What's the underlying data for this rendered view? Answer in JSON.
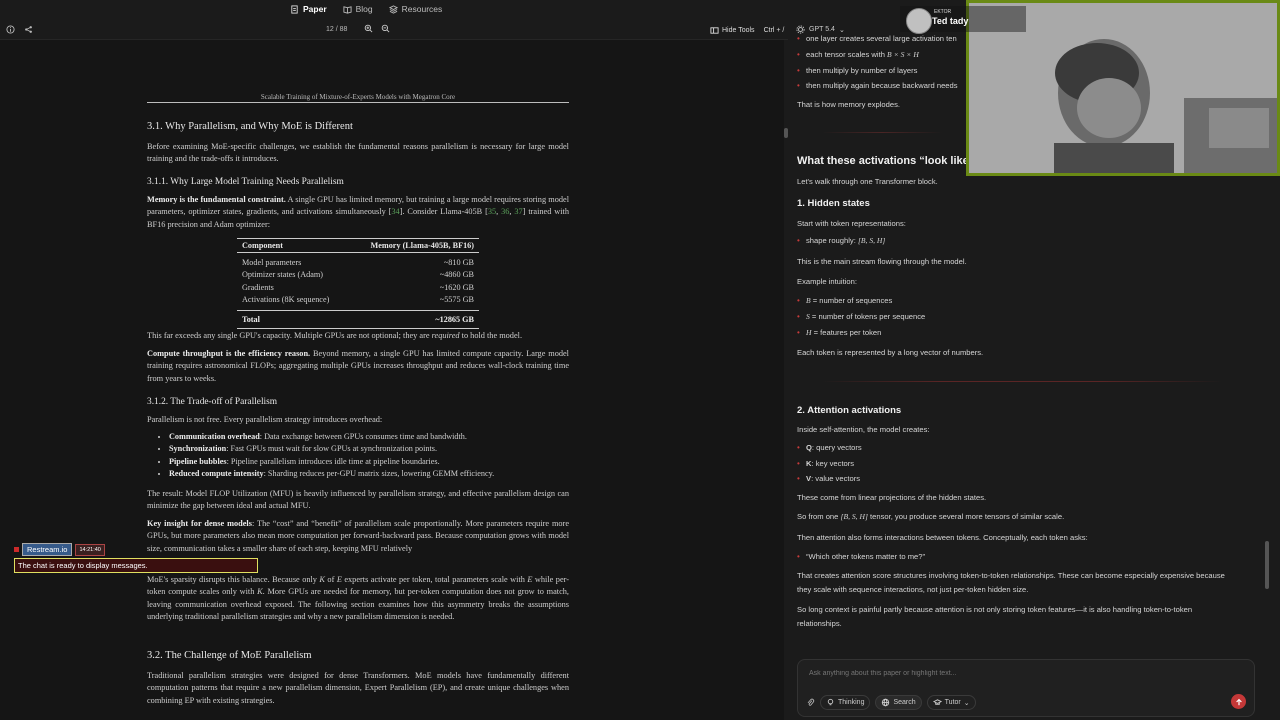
{
  "nav": {
    "tabs": [
      {
        "label": "Paper",
        "icon": "document-icon",
        "active": true
      },
      {
        "label": "Blog",
        "icon": "book-icon",
        "active": false
      },
      {
        "label": "Resources",
        "icon": "layers-icon",
        "active": false
      }
    ]
  },
  "pdf_toolbar": {
    "page_indicator": "12 / 88",
    "hide_tools_label": "Hide Tools",
    "hide_tools_shortcut": "Ctrl + /"
  },
  "paper": {
    "running_head": "Scalable Training of Mixture-of-Experts Models with Megatron Core",
    "s31_title": "3.1.  Why Parallelism, and Why MoE is Different",
    "s31_intro": "Before examining MoE-specific challenges, we establish the fundamental reasons parallelism is necessary for large model training and the trade-offs it introduces.",
    "s311_title": "3.1.1.  Why Large Model Training Needs Parallelism",
    "mem_lead": "Memory is the fundamental constraint.",
    "mem_text_a": " A single GPU has limited memory, but training a large model requires storing model parameters, optimizer states, gradients, and activations simultaneously [",
    "mem_cite1": "34",
    "mem_text_b": "]. Consider Llama-405B [",
    "mem_cite2": "35",
    "mem_cite3": "36",
    "mem_cite4": "37",
    "mem_text_c": "] trained with BF16 precision and Adam optimizer:",
    "table": {
      "col1": "Component",
      "col2": "Memory (Llama-405B, BF16)",
      "rows": [
        {
          "c": "Model parameters",
          "v": "~810 GB"
        },
        {
          "c": "Optimizer states (Adam)",
          "v": "~4860 GB"
        },
        {
          "c": "Gradients",
          "v": "~1620 GB"
        },
        {
          "c": "Activations (8K sequence)",
          "v": "~5575 GB"
        }
      ],
      "total_label": "Total",
      "total_value": "~12865 GB"
    },
    "exceeds_a": "This far exceeds any single GPU's capacity. Multiple GPUs are not optional; they are ",
    "exceeds_em": "required",
    "exceeds_b": " to hold the model.",
    "compute_lead": "Compute throughput is the efficiency reason.",
    "compute_text": " Beyond memory, a single GPU has limited compute capacity. Large model training requires astronomical FLOPs; aggregating multiple GPUs increases throughput and reduces wall-clock training time from years to weeks.",
    "s312_title": "3.1.2.  The Trade-off of Parallelism",
    "tradeoff_intro": "Parallelism is not free. Every parallelism strategy introduces overhead:",
    "bullets": [
      {
        "lead": "Communication overhead",
        "text": ": Data exchange between GPUs consumes time and bandwidth."
      },
      {
        "lead": "Synchronization",
        "text": ": Fast GPUs must wait for slow GPUs at synchronization points."
      },
      {
        "lead": "Pipeline bubbles",
        "text": ": Pipeline parallelism introduces idle time at pipeline boundaries."
      },
      {
        "lead": "Reduced compute intensity",
        "text": ": Sharding reduces per-GPU matrix sizes, lowering GEMM efficiency."
      }
    ],
    "result_text": "The result: Model FLOP Utilization (MFU) is heavily influenced by parallelism strategy, and effective parallelism design can minimize the gap between ideal and actual MFU.",
    "insight_lead": "Key insight for dense models",
    "insight_text": ": The “cost” and “benefit” of parallelism scale proportionally. More parameters require more GPUs, but more parameters also mean more computation per forward-backward pass. Because computation grows with model size, communication takes a smaller share of each step, keeping MFU relatively",
    "moe_text_a": "MoE's sparsity disrupts this balance. Because only ",
    "moe_K": "K",
    "moe_text_b": " of ",
    "moe_E": "E",
    "moe_text_c": " experts activate per token, total parameters scale with ",
    "moe_text_d": " while per-token compute scales only with ",
    "moe_text_e": ". More GPUs are needed for memory, but per-token computation does not grow to match, leaving communication overhead exposed. The following section examines how this asymmetry breaks the assumptions underlying traditional parallelism strategies and why a new parallelism dimension is needed.",
    "s32_title": "3.2.  The Challenge of MoE Parallelism",
    "s32_text": "Traditional parallelism strategies were designed for dense Transformers. MoE models have fundamentally different computation patterns that require a new parallelism dimension, Expert Parallelism (EP), and create unique challenges when combining EP with existing strategies."
  },
  "restream": {
    "name": "Restream.io",
    "time": "14:21:40",
    "message": "The chat is ready to display messages."
  },
  "assistant": {
    "model": "GPT 5.4",
    "top_line_1": "one layer creates several large activation ten",
    "top_line_2_a": "each tensor scales with ",
    "top_line_2_math": "B × S × H",
    "top_line_3": "then multiply by number of layers",
    "top_line_4": "then multiply again because backward needs",
    "memory_explodes": "That is how memory explodes.",
    "look_heading": "What these activations “look like",
    "walk": "Let's walk through one Transformer block.",
    "h1": "1. Hidden states",
    "start_with": "Start with token representations:",
    "shape_a": "shape roughly: ",
    "shape_math": "[B, S, H]",
    "main_stream": "This is the main stream flowing through the model.",
    "example": "Example intuition:",
    "defs": [
      {
        "sym": "B",
        "text": " = number of sequences"
      },
      {
        "sym": "S",
        "text": " = number of tokens per sequence"
      },
      {
        "sym": "H",
        "text": " = features per token"
      }
    ],
    "each_token": "Each token is represented by a long vector of numbers.",
    "h2": "2. Attention activations",
    "inside_attn": "Inside self-attention, the model creates:",
    "qkv": [
      {
        "k": "Q",
        "v": ": query vectors"
      },
      {
        "k": "K",
        "v": ": key vectors"
      },
      {
        "k": "V",
        "v": ": value vectors"
      }
    ],
    "linear_proj": "These come from linear projections of the hidden states.",
    "from_one_a": "So from one ",
    "from_one_math": "[B, S, H]",
    "from_one_b": " tensor, you produce several more tensors of similar scale.",
    "interactions": "Then attention also forms interactions between tokens. Conceptually, each token asks:",
    "which_tokens": "“Which other tokens matter to me?”",
    "score_1": "That creates attention score structures involving token-to-token relationships. These can become especially expensive because",
    "score_2": "they scale with sequence interactions, not just per-token hidden size.",
    "long_ctx_1": "So long context is painful partly because attention is not only storing token features—it is also handling token-to-token",
    "long_ctx_2": "relationships.",
    "input_placeholder": "Ask anything about this paper or highlight text...",
    "btn_thinking": "Thinking",
    "btn_search": "Search",
    "btn_tutor": "Tutor"
  },
  "webcam": {
    "label_small": "EKTOR",
    "name": "Ted tady"
  },
  "colors": {
    "accent_red": "#c43838",
    "cite_green": "#5aa05a",
    "webcam_border": "#6a8a15"
  }
}
